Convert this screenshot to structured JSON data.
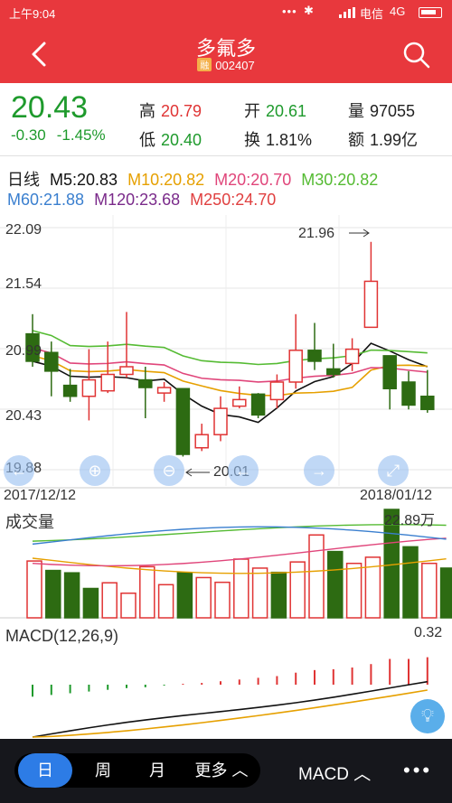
{
  "status_bar": {
    "time": "上午9:04",
    "carrier": "电信",
    "network": "4G"
  },
  "header": {
    "title": "多氟多",
    "stock_code": "002407",
    "badge": "融"
  },
  "quote": {
    "price": "20.43",
    "change": "-0.30",
    "change_pct": "-1.45%",
    "high_label": "高",
    "high": "20.79",
    "low_label": "低",
    "low": "20.40",
    "open_label": "开",
    "open": "20.61",
    "turnover_label": "换",
    "turnover": "1.81%",
    "volume_label": "量",
    "volume": "97055",
    "amount_label": "额",
    "amount": "1.99亿"
  },
  "ma_legend": {
    "period": "日线",
    "m5": "M5:20.83",
    "m10": "M10:20.82",
    "m20": "M20:20.70",
    "m30": "M30:20.82",
    "m60": "M60:21.88",
    "m120": "M120:23.68",
    "m250": "M250:24.70",
    "colors": {
      "m5": "#111111",
      "m10": "#e6a000",
      "m20": "#e0457a",
      "m30": "#55bb33",
      "m60": "#3a7fcf",
      "m120": "#7a2a8a",
      "m250": "#e04040"
    }
  },
  "kline": {
    "y_top": "22.09",
    "y_mid1": "21.54",
    "y_mid2": "20.99",
    "y_mid3": "20.43",
    "y_bottom": "19.88",
    "max_marker": "21.96",
    "min_marker": "20.01",
    "date_start": "2017/12/12",
    "date_end": "2018/01/12"
  },
  "volume": {
    "title": "成交量",
    "max": "22.89万"
  },
  "macd": {
    "title": "MACD(12,26,9)",
    "max": "0.32"
  },
  "chart_data": {
    "type": "candlestick",
    "x": [
      "2017/12/12",
      "",
      "",
      "",
      "",
      "",
      "",
      "",
      "",
      "",
      "",
      "",
      "",
      "",
      "",
      "",
      "",
      "",
      "",
      "",
      "",
      "",
      "2018/01/12"
    ],
    "ylim": [
      19.88,
      22.09
    ],
    "y_ticks": [
      "22.09",
      "21.54",
      "20.99",
      "20.43",
      "19.88"
    ],
    "candles": [
      {
        "o": 21.12,
        "c": 20.87,
        "h": 21.3,
        "l": 20.82,
        "up": false
      },
      {
        "o": 20.95,
        "c": 20.78,
        "h": 21.05,
        "l": 20.55,
        "up": false
      },
      {
        "o": 20.65,
        "c": 20.55,
        "h": 20.8,
        "l": 20.5,
        "up": false
      },
      {
        "o": 20.55,
        "c": 20.7,
        "h": 20.98,
        "l": 20.33,
        "up": true
      },
      {
        "o": 20.6,
        "c": 20.75,
        "h": 21.05,
        "l": 20.58,
        "up": true
      },
      {
        "o": 20.75,
        "c": 20.82,
        "h": 21.32,
        "l": 20.72,
        "up": true
      },
      {
        "o": 20.7,
        "c": 20.63,
        "h": 20.82,
        "l": 20.35,
        "up": false
      },
      {
        "o": 20.58,
        "c": 20.63,
        "h": 20.68,
        "l": 20.5,
        "up": true
      },
      {
        "o": 20.62,
        "c": 20.02,
        "h": 20.62,
        "l": 20.0,
        "up": false
      },
      {
        "o": 20.08,
        "c": 20.2,
        "h": 20.3,
        "l": 20.05,
        "up": true
      },
      {
        "o": 20.2,
        "c": 20.44,
        "h": 20.55,
        "l": 20.14,
        "up": true
      },
      {
        "o": 20.46,
        "c": 20.52,
        "h": 20.64,
        "l": 20.44,
        "up": true
      },
      {
        "o": 20.57,
        "c": 20.38,
        "h": 20.58,
        "l": 20.35,
        "up": false
      },
      {
        "o": 20.52,
        "c": 20.68,
        "h": 20.75,
        "l": 20.44,
        "up": true
      },
      {
        "o": 20.68,
        "c": 20.97,
        "h": 21.3,
        "l": 20.62,
        "up": true
      },
      {
        "o": 20.97,
        "c": 20.87,
        "h": 21.22,
        "l": 20.79,
        "up": false
      },
      {
        "o": 20.8,
        "c": 20.75,
        "h": 21.03,
        "l": 20.72,
        "up": false
      },
      {
        "o": 20.85,
        "c": 20.98,
        "h": 21.08,
        "l": 20.78,
        "up": true
      },
      {
        "o": 21.18,
        "c": 21.6,
        "h": 21.96,
        "l": 21.18,
        "up": true
      },
      {
        "o": 20.92,
        "c": 20.62,
        "h": 20.92,
        "l": 20.43,
        "up": false
      },
      {
        "o": 20.68,
        "c": 20.47,
        "h": 20.78,
        "l": 20.43,
        "up": false
      },
      {
        "o": 20.55,
        "c": 20.43,
        "h": 20.79,
        "l": 20.4,
        "up": false
      }
    ],
    "volume_max": 22.89,
    "volumes": [
      {
        "v": 12.0,
        "up": true
      },
      {
        "v": 10.0,
        "up": false
      },
      {
        "v": 9.5,
        "up": false
      },
      {
        "v": 6.2,
        "up": false
      },
      {
        "v": 7.4,
        "up": true
      },
      {
        "v": 5.2,
        "up": true
      },
      {
        "v": 10.8,
        "up": true
      },
      {
        "v": 7.0,
        "up": true
      },
      {
        "v": 9.5,
        "up": false
      },
      {
        "v": 8.5,
        "up": true
      },
      {
        "v": 7.5,
        "up": true
      },
      {
        "v": 12.4,
        "up": true
      },
      {
        "v": 10.5,
        "up": true
      },
      {
        "v": 9.6,
        "up": false
      },
      {
        "v": 11.8,
        "up": true
      },
      {
        "v": 17.5,
        "up": true
      },
      {
        "v": 14.0,
        "up": false
      },
      {
        "v": 11.5,
        "up": true
      },
      {
        "v": 12.8,
        "up": true
      },
      {
        "v": 22.89,
        "up": false
      },
      {
        "v": 15.0,
        "up": false
      },
      {
        "v": 11.5,
        "up": true
      },
      {
        "v": 10.5,
        "up": false
      }
    ],
    "macd_bars": [
      -0.14,
      -0.12,
      -0.1,
      -0.08,
      -0.06,
      -0.04,
      -0.03,
      -0.01,
      0.01,
      0.02,
      0.04,
      0.06,
      0.08,
      0.1,
      0.14,
      0.17,
      0.18,
      0.2,
      0.24,
      0.3,
      0.3,
      0.32
    ]
  }
}
